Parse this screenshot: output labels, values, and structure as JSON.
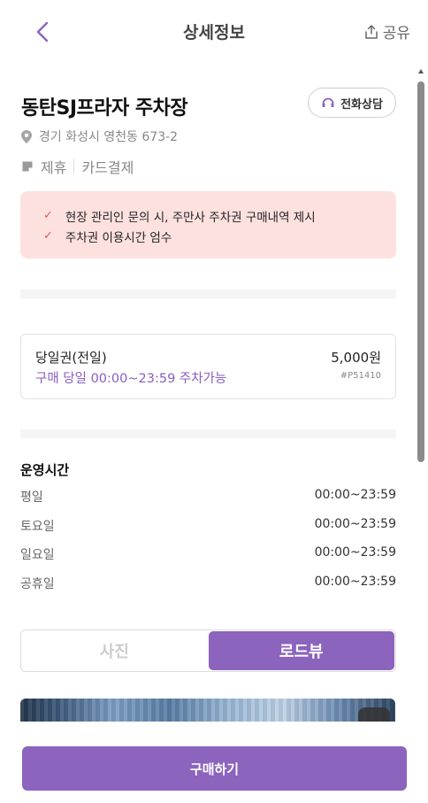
{
  "header": {
    "title": "상세정보",
    "share_label": "공유"
  },
  "place": {
    "name": "동탄SJ프라자 주차장",
    "call_label": "전화상담",
    "address": "경기 화성시 영천동 673-2",
    "tags": [
      "제휴",
      "카드결제"
    ]
  },
  "notices": [
    "현장 관리인 문의 시, 주만사 주차권 구매내역 제시",
    "주차권 이용시간 엄수"
  ],
  "ticket": {
    "name": "당일권(전일)",
    "price": "5,000원",
    "desc": "구매 당일 00:00~23:59 주차가능",
    "code": "#P51410"
  },
  "hours": {
    "title": "운영시간",
    "rows": [
      {
        "day": "평일",
        "time": "00:00~23:59"
      },
      {
        "day": "토요일",
        "time": "00:00~23:59"
      },
      {
        "day": "일요일",
        "time": "00:00~23:59"
      },
      {
        "day": "공휴일",
        "time": "00:00~23:59"
      }
    ]
  },
  "view_toggle": {
    "photo_label": "사진",
    "roadview_label": "로드뷰",
    "selected": "로드뷰"
  },
  "purchase": {
    "button_label": "구매하기"
  },
  "colors": {
    "accent": "#8c63bd",
    "notice_bg": "#fde1df",
    "check": "#e05a52"
  }
}
